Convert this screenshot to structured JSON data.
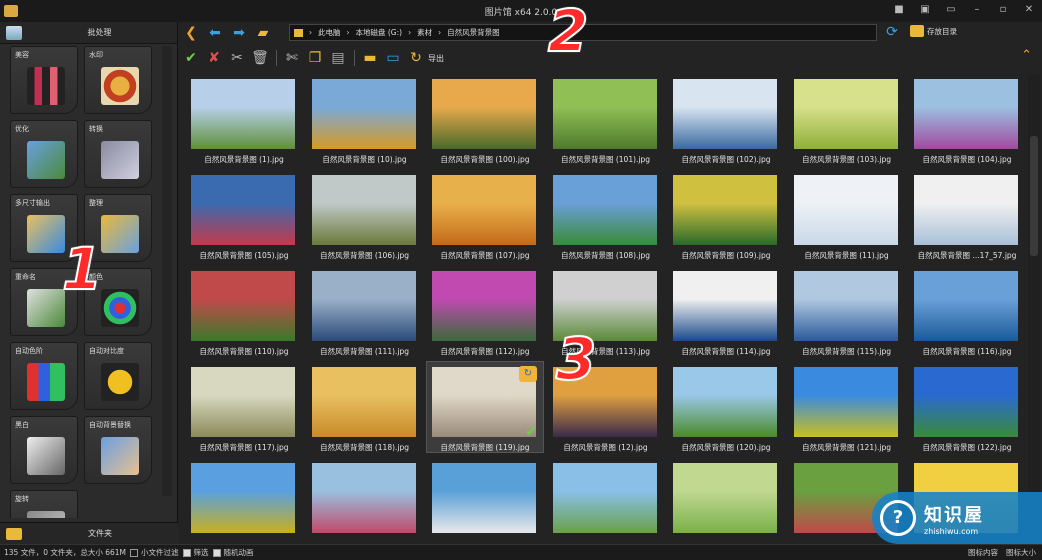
{
  "window": {
    "title": "图片馆 x64 2.0.0"
  },
  "left_panel": {
    "header": "批处理",
    "footer": "文件夹",
    "tools": [
      {
        "label": "美容",
        "icon": "lipstick-icon"
      },
      {
        "label": "水印",
        "icon": "stamp-icon"
      },
      {
        "label": "优化",
        "icon": "photo-enhance-icon"
      },
      {
        "label": "转换",
        "icon": "convert-icon"
      },
      {
        "label": "多尺寸输出",
        "icon": "multisize-icon"
      },
      {
        "label": "整理",
        "icon": "organize-icon"
      },
      {
        "label": "重命名",
        "icon": "rename-icon"
      },
      {
        "label": "颜色",
        "icon": "color-icon"
      },
      {
        "label": "自动色阶",
        "icon": "levels-icon"
      },
      {
        "label": "自动对比度",
        "icon": "contrast-icon"
      },
      {
        "label": "黑白",
        "icon": "grayscale-icon"
      },
      {
        "label": "自动背景替换",
        "icon": "background-replace-icon"
      },
      {
        "label": "旋转",
        "icon": "rotate-icon"
      }
    ]
  },
  "navbar": {
    "path": [
      "此电脑",
      "本地磁盘 (G:)",
      "素材",
      "自然风景背景图"
    ],
    "save_to": "存放目录"
  },
  "toolbar": {
    "export_label": "导出"
  },
  "thumbnails": [
    {
      "caption": "自然风景背景图 (1).jpg",
      "c1": "#5f8f3a",
      "c2": "#b7cfe8"
    },
    {
      "caption": "自然风景背景图 (10).jpg",
      "c1": "#d69a24",
      "c2": "#7aa9d8"
    },
    {
      "caption": "自然风景背景图 (100).jpg",
      "c1": "#4a6a2a",
      "c2": "#e7a94b"
    },
    {
      "caption": "自然风景背景图 (101).jpg",
      "c1": "#4f7a2e",
      "c2": "#8fbf55"
    },
    {
      "caption": "自然风景背景图 (102).jpg",
      "c1": "#3a6aa0",
      "c2": "#d8e4f0"
    },
    {
      "caption": "自然风景背景图 (103).jpg",
      "c1": "#8fb03a",
      "c2": "#d7e08a"
    },
    {
      "caption": "自然风景背景图 (104).jpg",
      "c1": "#a04aa0",
      "c2": "#9cc0e0"
    },
    {
      "caption": "自然风景背景图 (105).jpg",
      "c1": "#c43a4a",
      "c2": "#3a6ab0"
    },
    {
      "caption": "自然风景背景图 (106).jpg",
      "c1": "#6a7a3a",
      "c2": "#c0c8c8"
    },
    {
      "caption": "自然风景背景图 (107).jpg",
      "c1": "#c46a1a",
      "c2": "#e8b04a"
    },
    {
      "caption": "自然风景背景图 (108).jpg",
      "c1": "#3a8a3a",
      "c2": "#6aa0d8"
    },
    {
      "caption": "自然风景背景图 (109).jpg",
      "c1": "#2a6a2a",
      "c2": "#d0c040"
    },
    {
      "caption": "自然风景背景图 (11).jpg",
      "c1": "#c8d8e8",
      "c2": "#eef2f6"
    },
    {
      "caption": "自然风景背景图 ...17_57.jpg",
      "c1": "#a8c0d8",
      "c2": "#f0f0f0"
    },
    {
      "caption": "自然风景背景图 (110).jpg",
      "c1": "#3a7a2a",
      "c2": "#c04a4a"
    },
    {
      "caption": "自然风景背景图 (111).jpg",
      "c1": "#2a4a7a",
      "c2": "#9ab0c8"
    },
    {
      "caption": "自然风景背景图 (112).jpg",
      "c1": "#3a6a3a",
      "c2": "#c04ab0"
    },
    {
      "caption": "自然风景背景图 (113).jpg",
      "c1": "#5a8a3a",
      "c2": "#d0d0d0"
    },
    {
      "caption": "自然风景背景图 (114).jpg",
      "c1": "#1a4a8a",
      "c2": "#f0f0f0"
    },
    {
      "caption": "自然风景背景图 (115).jpg",
      "c1": "#2a5a9a",
      "c2": "#b0c8e0"
    },
    {
      "caption": "自然风景背景图 (116).jpg",
      "c1": "#1a5a9a",
      "c2": "#6aa0d8"
    },
    {
      "caption": "自然风景背景图 (117).jpg",
      "c1": "#8a8a5a",
      "c2": "#d8d8c0"
    },
    {
      "caption": "自然风景背景图 (118).jpg",
      "c1": "#c88a2a",
      "c2": "#e8c060"
    },
    {
      "caption": "自然风景背景图 (119).jpg",
      "c1": "#9a8a7a",
      "c2": "#e0d8c8"
    },
    {
      "caption": "自然风景背景图 (12).jpg",
      "c1": "#3a2a4a",
      "c2": "#e0a040"
    },
    {
      "caption": "自然风景背景图 (120).jpg",
      "c1": "#4a8a2a",
      "c2": "#9ac8e8"
    },
    {
      "caption": "自然风景背景图 (121).jpg",
      "c1": "#c8c020",
      "c2": "#3a8ae0"
    },
    {
      "caption": "自然风景背景图 (122).jpg",
      "c1": "#3a8a3a",
      "c2": "#2a6ad0"
    },
    {
      "caption": "自然风景背景图 (123).jpg",
      "c1": "#c8b020",
      "c2": "#5aa0e0"
    },
    {
      "caption": "自然风景背景图 (124).jpg",
      "c1": "#c04a6a",
      "c2": "#9ac0e0"
    },
    {
      "caption": "自然风景背景图 (125).jpg",
      "c1": "#e8e8e8",
      "c2": "#5aa0d8"
    },
    {
      "caption": "自然风景背景图 (126).jpg",
      "c1": "#6aa04a",
      "c2": "#8ac0e8"
    },
    {
      "caption": "自然风景背景图 (127).jpg",
      "c1": "#7ab04a",
      "c2": "#c0d890"
    },
    {
      "caption": "",
      "c1": "#c04a4a",
      "c2": "#6aa040"
    },
    {
      "caption": "",
      "c1": "#d8a020",
      "c2": "#f0d040"
    }
  ],
  "selected_index": 23,
  "status": {
    "summary": "135 文件，0 文件夹，总大小 661M",
    "option1": "小文件过滤",
    "option2": "筛选",
    "option3": "随机动画",
    "right1": "图标内容",
    "right2": "图标大小"
  },
  "annotations": [
    "1",
    "2",
    "3"
  ],
  "watermark": {
    "brand": "知识屋",
    "site": "zhishiwu.com"
  }
}
